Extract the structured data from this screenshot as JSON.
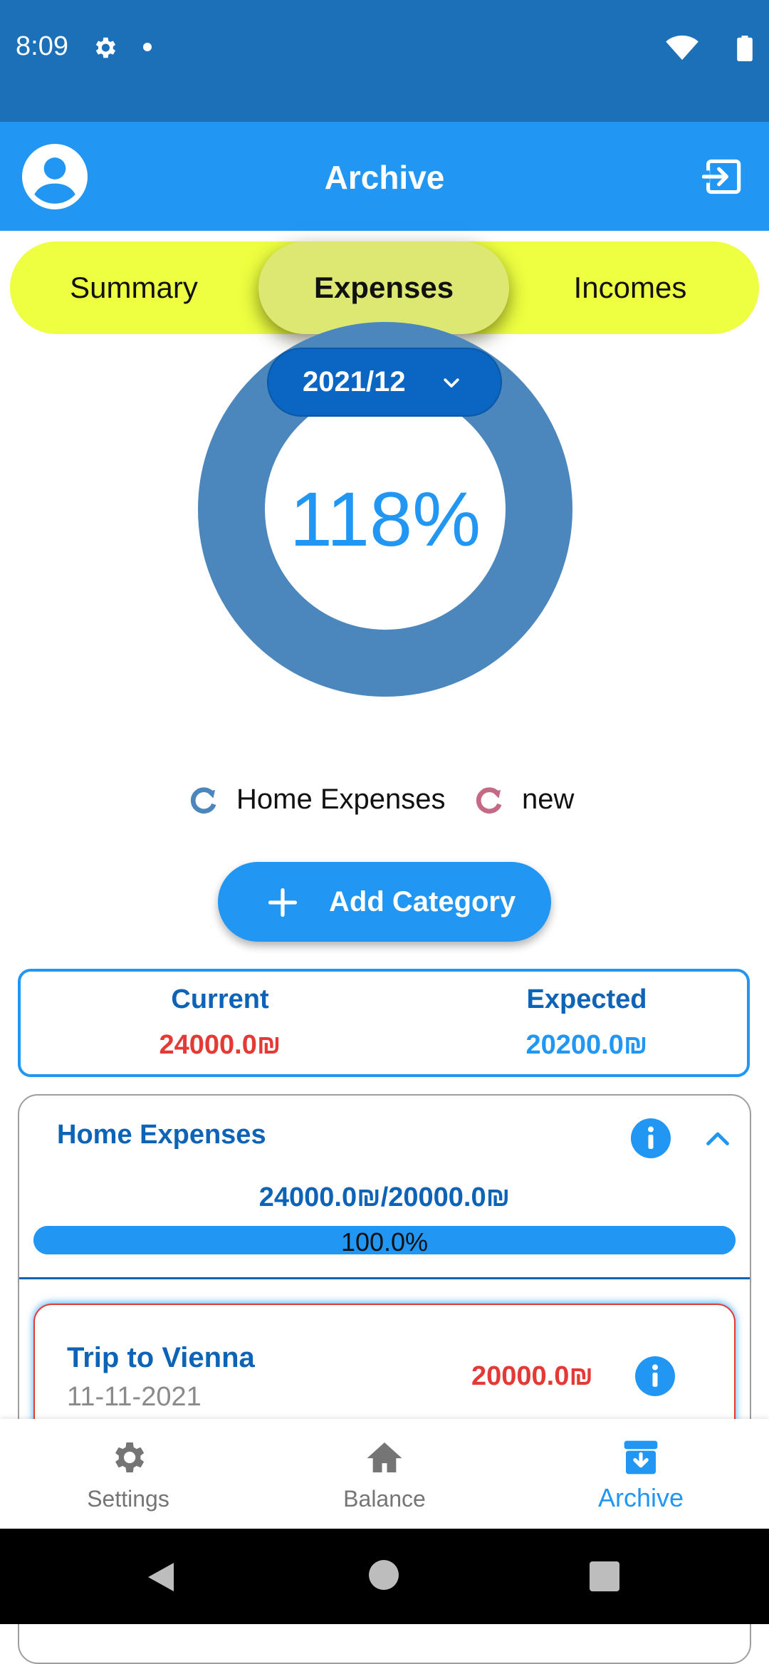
{
  "status_bar": {
    "time": "8:09"
  },
  "app_bar": {
    "title": "Archive"
  },
  "tabs": [
    {
      "label": "Summary"
    },
    {
      "label": "Expenses"
    },
    {
      "label": "Incomes"
    }
  ],
  "selected_tab": "Expenses",
  "chart": {
    "date_selector": "2021/12",
    "percent_label": "118%",
    "ring_color": "#4b87bd",
    "legend": [
      {
        "label": "Home Expenses",
        "color": "#4b87bd"
      },
      {
        "label": "new",
        "color": "#c46a84"
      }
    ]
  },
  "add_category": {
    "label": "Add Category"
  },
  "totals": {
    "current_label": "Current",
    "current_value": "24000.0₪",
    "expected_label": "Expected",
    "expected_value": "20200.0₪"
  },
  "category": {
    "title": "Home Expenses",
    "amounts": "24000.0₪/20000.0₪",
    "progress_text": "100.0%",
    "progress_fraction": 1.0,
    "items": [
      {
        "title": "Trip to Vienna",
        "date": "11-11-2021",
        "amount": "20000.0₪"
      }
    ]
  },
  "bottom_nav": [
    {
      "label": "Settings",
      "icon": "gear-icon"
    },
    {
      "label": "Balance",
      "icon": "home-icon"
    },
    {
      "label": "Archive",
      "icon": "archive-icon",
      "active": true
    }
  ],
  "colors": {
    "status_bar": "#1c70b8",
    "app_bar": "#2196f3",
    "tabs_background": "#eeff41",
    "selected_tab": "#dde873",
    "over_budget": "#e53935",
    "accent_dark": "#0d63b5"
  }
}
